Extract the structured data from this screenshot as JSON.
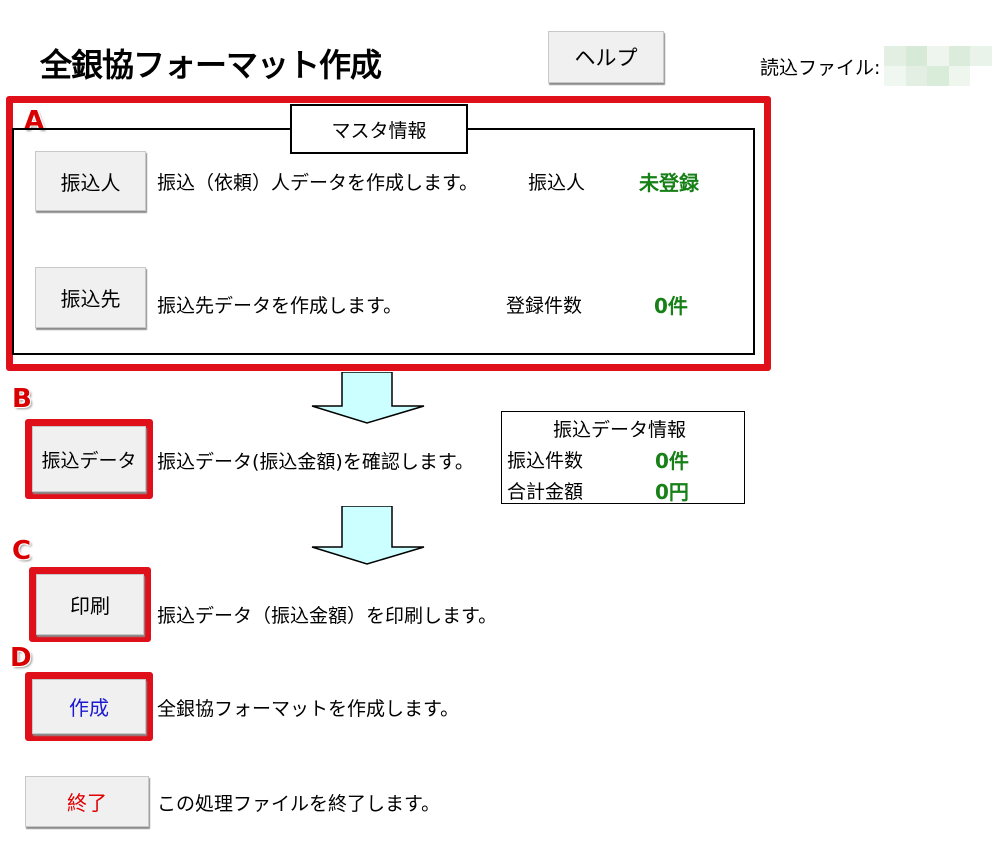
{
  "page": {
    "title": "全銀協フォーマット作成",
    "help_button": "ヘルプ",
    "file_label": "読込ファイル:"
  },
  "colors": {
    "accent_red": "#e0101a",
    "status_green": "#178017",
    "create_blue": "#1a1ad0",
    "exit_red": "#e00000",
    "arrow_fill": "#ccffff"
  },
  "badges": {
    "a": "A",
    "b": "B",
    "c": "C",
    "d": "D"
  },
  "master": {
    "legend": "マスタ情報",
    "payer": {
      "button": "振込人",
      "description": "振込（依頼）人データを作成します。",
      "status_label": "振込人",
      "status_value": "未登録"
    },
    "payee": {
      "button": "振込先",
      "description": "振込先データを作成します。",
      "status_label": "登録件数",
      "status_value": "0件"
    }
  },
  "transfer": {
    "button": "振込データ",
    "description": "振込データ(振込金額)を確認します。",
    "info_title": "振込データ情報",
    "count_label": "振込件数",
    "count_value": "0件",
    "total_label": "合計金額",
    "total_value": "0円"
  },
  "print": {
    "button": "印刷",
    "description": "振込データ（振込金額）を印刷します。"
  },
  "create": {
    "button": "作成",
    "description": "全銀協フォーマットを作成します。"
  },
  "exit": {
    "button": "終了",
    "description": "この処理ファイルを終了します。"
  }
}
